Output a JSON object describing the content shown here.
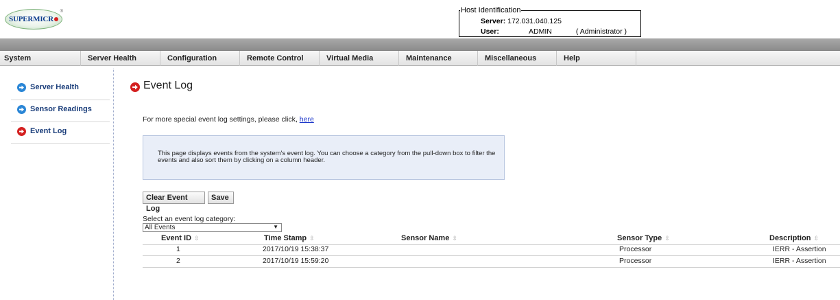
{
  "logo": {
    "text": "SUPERMICR",
    "registered": "®"
  },
  "host": {
    "legend": "Host Identification",
    "server_label": "Server:",
    "server_value": "172.031.040.125",
    "user_label": "User:",
    "user_value": "ADMIN",
    "role": "( Administrator )"
  },
  "nav": [
    "System",
    "Server Health",
    "Configuration",
    "Remote Control",
    "Virtual Media",
    "Maintenance",
    "Miscellaneous",
    "Help"
  ],
  "sidebar": [
    {
      "label": "Server Health",
      "icon": "blue-arrow-icon"
    },
    {
      "label": "Sensor Readings",
      "icon": "blue-arrow-icon"
    },
    {
      "label": "Event Log",
      "icon": "red-arrow-icon",
      "active": true
    }
  ],
  "page": {
    "title": "Event Log",
    "settings_text": "For more special event log settings, please click",
    "settings_link": "here",
    "info_text": "This page displays events from the system's event log. You can choose a category from the pull-down box to filter the events and also sort them by clicking on a column header.",
    "clear_button": "Clear Event Log",
    "save_button": "Save",
    "select_label": "Select an event log category:",
    "select_value": "All Events"
  },
  "table": {
    "headers": [
      "Event ID",
      "Time Stamp",
      "Sensor Name",
      "Sensor Type",
      "Description"
    ],
    "rows": [
      [
        "1",
        "2017/10/19 15:38:37",
        "",
        "Processor",
        "IERR - Assertion"
      ],
      [
        "2",
        "2017/10/19 15:59:20",
        "",
        "Processor",
        "IERR - Assertion"
      ]
    ]
  },
  "colors": {
    "accent_red": "#d42020",
    "accent_blue": "#2a86d6",
    "info_bg": "#e9eef8"
  }
}
